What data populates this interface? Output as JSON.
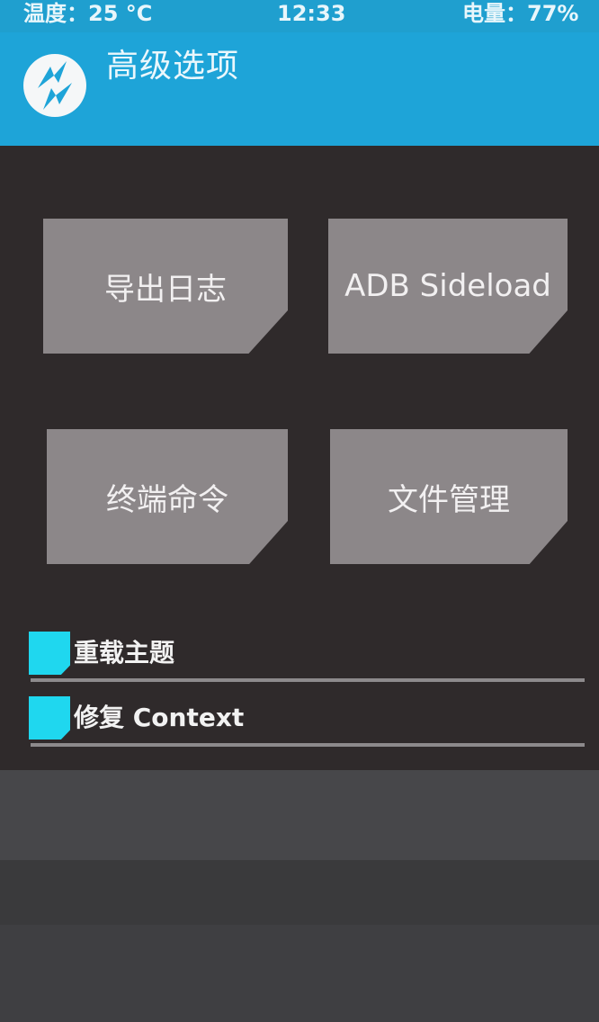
{
  "status_bar": {
    "temperature": "温度：25 °C",
    "time": "12:33",
    "battery": "电量：77%"
  },
  "header": {
    "title": "高级选项",
    "logo_icon": "twrp-logo-icon"
  },
  "buttons": {
    "export_log": "导出日志",
    "adb_sideload": "ADB Sideload",
    "terminal": "终端命令",
    "file_manager": "文件管理"
  },
  "options": [
    {
      "label": "重载主题"
    },
    {
      "label": "修复 Context"
    }
  ],
  "colors": {
    "accent": "#1ea4d8",
    "checkbox": "#1fd7ef",
    "button": "#8c8789",
    "background": "#2f2a2b"
  }
}
